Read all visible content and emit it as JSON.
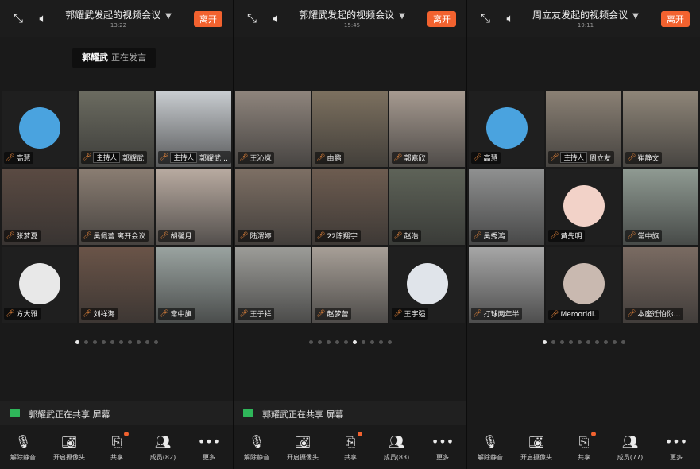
{
  "toolbar_labels": {
    "unmute": "解除静音",
    "camera": "开启摄像头",
    "share": "共享",
    "more": "更多"
  },
  "leave_label": "离开",
  "speaking_suffix": "正在发言",
  "panels": [
    {
      "title": "郭耀武发起的视频会议",
      "timer": "13:22",
      "speaker": "郭耀武",
      "share_text": "郭耀武正在共享 屏幕",
      "members_label": "成员(82)",
      "active_dot": 0,
      "tiles": [
        {
          "name": "高慧",
          "kind": "avatar",
          "color": "#4aa3df"
        },
        {
          "name": "郭耀武",
          "host": "主持人",
          "kind": "video",
          "color": "#6b6b60",
          "active": true
        },
        {
          "name": "郭耀武…",
          "host": "主持人",
          "kind": "video",
          "color": "#c8ccd0",
          "active": true
        },
        {
          "name": "张梦夏",
          "kind": "video",
          "color": "#5a4a42"
        },
        {
          "name": "吴佩蕾 离开会议",
          "kind": "video",
          "color": "#8a7d72"
        },
        {
          "name": "胡馨月",
          "kind": "video",
          "color": "#b8aaa0"
        },
        {
          "name": "方大雅",
          "kind": "avatar",
          "color": "#e8e8e8"
        },
        {
          "name": "刘祥海",
          "kind": "video",
          "color": "#6a5448"
        },
        {
          "name": "常中旗",
          "kind": "video",
          "color": "#9aa3a0"
        }
      ]
    },
    {
      "title": "郭耀武发起的视频会议",
      "timer": "15:45",
      "speaker": "",
      "share_text": "郭耀武正在共享 屏幕",
      "members_label": "成员(83)",
      "active_dot": 5,
      "tiles": [
        {
          "name": "王沁岚",
          "kind": "video",
          "color": "#8e847c"
        },
        {
          "name": "由鹏",
          "kind": "video",
          "color": "#7c705f"
        },
        {
          "name": "郭嘉欣",
          "kind": "video",
          "color": "#a69a90"
        },
        {
          "name": "陆渭婷",
          "kind": "video",
          "color": "#7d6f64"
        },
        {
          "name": "22陈翔宇",
          "kind": "video",
          "color": "#6d5c50"
        },
        {
          "name": "赵浩",
          "kind": "video",
          "color": "#5e6358"
        },
        {
          "name": "王子祥",
          "kind": "video",
          "color": "#9c9c98"
        },
        {
          "name": "赵梦蕾",
          "kind": "video",
          "color": "#a79f97"
        },
        {
          "name": "王宇强",
          "kind": "avatar",
          "color": "#e0e4ea"
        }
      ]
    },
    {
      "title": "周立友发起的视频会议",
      "timer": "19:11",
      "speaker": "",
      "share_text": "",
      "members_label": "成员(77)",
      "active_dot": 0,
      "tiles": [
        {
          "name": "高慧",
          "kind": "avatar",
          "color": "#4aa3df"
        },
        {
          "name": "周立友",
          "host": "主持人",
          "kind": "video",
          "color": "#8a8074"
        },
        {
          "name": "崔静文",
          "kind": "video",
          "color": "#8e8578"
        },
        {
          "name": "吴秀鸿",
          "kind": "video",
          "color": "#8f9090"
        },
        {
          "name": "黄先明",
          "kind": "avatar",
          "color": "#f2d2c8"
        },
        {
          "name": "常中旗",
          "kind": "video",
          "color": "#8f9a92"
        },
        {
          "name": "打球两年半",
          "kind": "video",
          "color": "#a6a6a6"
        },
        {
          "name": "Memoridl.",
          "kind": "avatar",
          "color": "#c9b9b0"
        },
        {
          "name": "本座迁怕你…",
          "kind": "video",
          "color": "#7a6b62"
        }
      ]
    }
  ]
}
